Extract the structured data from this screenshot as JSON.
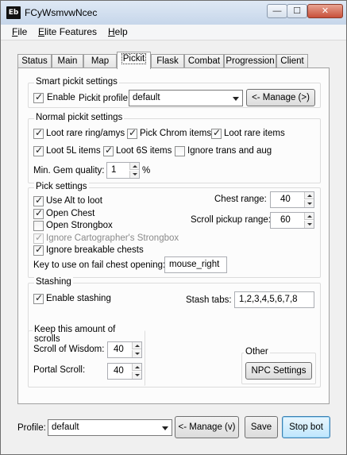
{
  "window": {
    "icon_text": "Eb",
    "title": "FCyWsmvwNcec",
    "min_glyph": "—",
    "max_glyph": "☐",
    "close_glyph": "✕"
  },
  "menu": [
    {
      "label": "File",
      "underline": "F",
      "rest": "ile"
    },
    {
      "label": "Elite Features",
      "underline": "E",
      "rest": "lite Features"
    },
    {
      "label": "Help",
      "underline": "H",
      "rest": "elp"
    }
  ],
  "tabs": [
    "Status",
    "Main",
    "Map",
    "Pickit",
    "Flask",
    "Combat",
    "Progression",
    "Client"
  ],
  "active_tab": "Pickit",
  "smart": {
    "title": "Smart pickit settings",
    "enable_label": "Enable",
    "enable_checked": true,
    "profile_label": "Pickit profile:",
    "profile_value": "default",
    "manage_label": "<- Manage (>)"
  },
  "normal": {
    "title": "Normal pickit settings",
    "items": [
      {
        "label": "Loot rare ring/amys",
        "checked": true
      },
      {
        "label": "Pick Chrom items",
        "checked": true
      },
      {
        "label": "Loot rare items",
        "checked": true
      },
      {
        "label": "Loot 5L items",
        "checked": true
      },
      {
        "label": "Loot 6S items",
        "checked": true
      },
      {
        "label": "Ignore trans and aug",
        "checked": false
      }
    ],
    "gem_label": "Min. Gem quality:",
    "gem_value": "1",
    "gem_unit": "%"
  },
  "pick": {
    "title": "Pick settings",
    "items": [
      {
        "label": "Use Alt to loot",
        "checked": true,
        "disabled": false
      },
      {
        "label": "Open Chest",
        "checked": true,
        "disabled": false
      },
      {
        "label": "Open Strongbox",
        "checked": false,
        "disabled": false
      },
      {
        "label": "Ignore Cartographer's Strongbox",
        "checked": true,
        "disabled": true
      },
      {
        "label": "Ignore breakable chests",
        "checked": true,
        "disabled": false
      }
    ],
    "chest_range_label": "Chest range:",
    "chest_range_value": "40",
    "scroll_range_label": "Scroll pickup range:",
    "scroll_range_value": "60",
    "fail_key_label": "Key to use on fail chest opening:",
    "fail_key_value": "mouse_right"
  },
  "stash": {
    "title": "Stashing",
    "enable_label": "Enable stashing",
    "enable_checked": true,
    "tabs_label": "Stash tabs:",
    "tabs_value": "1,2,3,4,5,6,7,8",
    "scrolls_title": "Keep this amount of scrolls",
    "wisdom_label": "Scroll of Wisdom:",
    "wisdom_value": "40",
    "portal_label": "Portal Scroll:",
    "portal_value": "40",
    "other_title": "Other",
    "npc_label": "NPC Settings"
  },
  "footer": {
    "profile_label": "Profile:",
    "profile_value": "default",
    "manage_label": "<- Manage (v)",
    "save_label": "Save",
    "stop_label": "Stop bot"
  }
}
